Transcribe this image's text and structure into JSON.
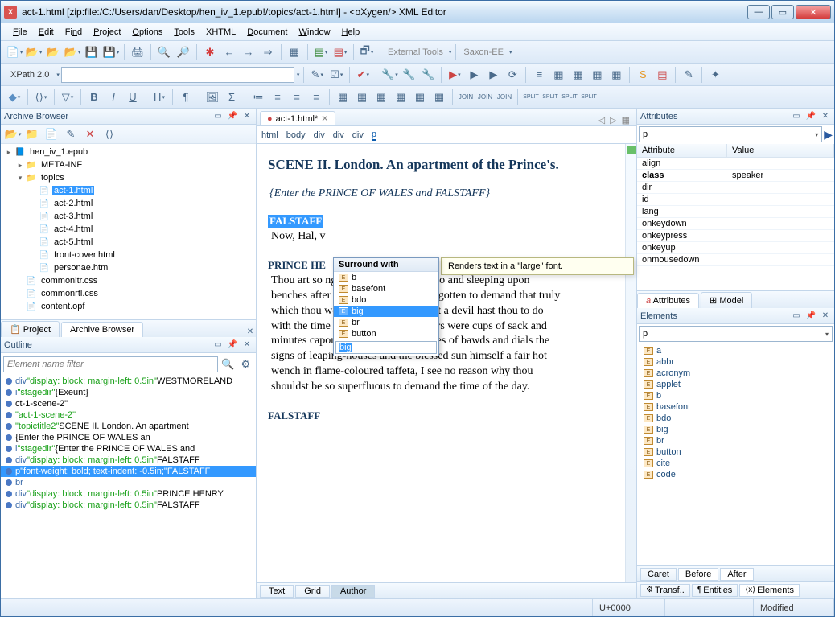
{
  "title": "act-1.html [zip:file:/C:/Users/dan/Desktop/hen_iv_1.epub!/topics/act-1.html] - <oXygen/> XML Editor",
  "app_glyph": "X",
  "menu": [
    "File",
    "Edit",
    "Find",
    "Project",
    "Options",
    "Tools",
    "XHTML",
    "Document",
    "Window",
    "Help"
  ],
  "xpath_label": "XPath 2.0",
  "external_tools_label": "External Tools",
  "saxon_label": "Saxon-EE",
  "left": {
    "archive_title": "Archive Browser",
    "project_tab": "Project",
    "archive_tab": "Archive Browser",
    "tree": [
      {
        "d": 0,
        "icon": "📘",
        "label": "hen_iv_1.epub",
        "twist": "▸"
      },
      {
        "d": 1,
        "icon": "📁",
        "label": "META-INF",
        "twist": "▸"
      },
      {
        "d": 1,
        "icon": "📁",
        "label": "topics",
        "twist": "▾"
      },
      {
        "d": 2,
        "icon": "📄",
        "label": "act-1.html",
        "sel": true
      },
      {
        "d": 2,
        "icon": "📄",
        "label": "act-2.html"
      },
      {
        "d": 2,
        "icon": "📄",
        "label": "act-3.html"
      },
      {
        "d": 2,
        "icon": "📄",
        "label": "act-4.html"
      },
      {
        "d": 2,
        "icon": "📄",
        "label": "act-5.html"
      },
      {
        "d": 2,
        "icon": "📄",
        "label": "front-cover.html"
      },
      {
        "d": 2,
        "icon": "📄",
        "label": "personae.html"
      },
      {
        "d": 1,
        "icon": "📄",
        "label": "commonltr.css"
      },
      {
        "d": 1,
        "icon": "📄",
        "label": "commonrtl.css"
      },
      {
        "d": 1,
        "icon": "📄",
        "label": "content.opf"
      }
    ],
    "outline_title": "Outline",
    "outline_placeholder": "Element name filter",
    "outline": [
      {
        "t": "div",
        "s": "\"display: block; margin-left: 0.5in\"",
        "x": " WESTMORELAND"
      },
      {
        "t": "i",
        "s": "\"stagedir\"",
        "x": " {Exeunt}"
      },
      {
        "t": "",
        "s": "",
        "x": "ct-1-scene-2\"",
        "cls": "sty"
      },
      {
        "t": "",
        "s": "\"act-1-scene-2\"",
        "x": ""
      },
      {
        "t": "",
        "s": "\"topictitle2\"",
        "x": " SCENE II. London. An apartment"
      },
      {
        "t": "",
        "s": "",
        "x": "  {Enter the PRINCE OF WALES an"
      },
      {
        "t": "i",
        "s": "\"stagedir\"",
        "x": " {Enter the PRINCE OF WALES and"
      },
      {
        "t": "div",
        "s": "\"display: block; margin-left: 0.5in\"",
        "x": " FALSTAFF"
      },
      {
        "t": "p",
        "s": "\"font-weight: bold; text-indent: -0.5in;\"",
        "x": " FALSTAFF",
        "sel": true
      },
      {
        "t": "br",
        "s": "",
        "x": ""
      },
      {
        "t": "div",
        "s": "\"display: block; margin-left: 0.5in\"",
        "x": " PRINCE HENRY"
      },
      {
        "t": "div",
        "s": "\"display: block; margin-left: 0.5in\"",
        "x": " FALSTAFF"
      }
    ]
  },
  "center": {
    "tab": "act-1.html*",
    "breadcrumb": [
      "html",
      "body",
      "div",
      "div",
      "div",
      "p"
    ],
    "scene": "SCENE II. London. An apartment of the Prince's.",
    "stage": "{Enter the PRINCE OF WALES and FALSTAFF}",
    "sp1": "FALSTAFF",
    "line1": "Now, Hal, v",
    "sp2": "PRINCE HE",
    "speech2": "Thou art so                               ng of old sack and unbutto                             and sleeping upon benches after noon, that thou hast forgotten to demand that truly which thou wouldst truly know. What a devil hast thou to do with the time of the day? Unless hours were cups of sack and minutes capons and clocks the tongues of bawds and dials the signs of leaping-houses and the blessed sun himself a fair hot wench in flame-coloured taffeta, I see no reason why thou shouldst be so superfluous to demand the time of the day.",
    "sp3": "FALSTAFF",
    "modes": [
      "Text",
      "Grid",
      "Author"
    ]
  },
  "right": {
    "attributes_title": "Attributes",
    "combo": "p",
    "cols": [
      "Attribute",
      "Value"
    ],
    "rows": [
      {
        "a": "align",
        "v": ""
      },
      {
        "a": "class",
        "v": "speaker",
        "b": true
      },
      {
        "a": "dir",
        "v": ""
      },
      {
        "a": "id",
        "v": ""
      },
      {
        "a": "lang",
        "v": ""
      },
      {
        "a": "onkeydown",
        "v": ""
      },
      {
        "a": "onkeypress",
        "v": ""
      },
      {
        "a": "onkeyup",
        "v": ""
      },
      {
        "a": "onmousedown",
        "v": ""
      }
    ],
    "attr_tab": "Attributes",
    "model_tab": "Model",
    "elements_title": "Elements",
    "elem_combo": "p",
    "elems": [
      "a",
      "abbr",
      "acronym",
      "applet",
      "b",
      "basefont",
      "bdo",
      "big",
      "br",
      "button",
      "cite",
      "code"
    ],
    "caret_tabs": [
      "Caret",
      "Before",
      "After"
    ],
    "bottom_tabs": [
      "Transf..",
      "Entities",
      "Elements"
    ]
  },
  "popup": {
    "title": "Surround with",
    "items": [
      "b",
      "basefont",
      "bdo",
      "big",
      "br",
      "button"
    ],
    "selected": "big",
    "filter": "big"
  },
  "tooltip": "Renders text in a \"large\" font.",
  "status": {
    "unicode": "U+0000",
    "modified": "Modified"
  }
}
